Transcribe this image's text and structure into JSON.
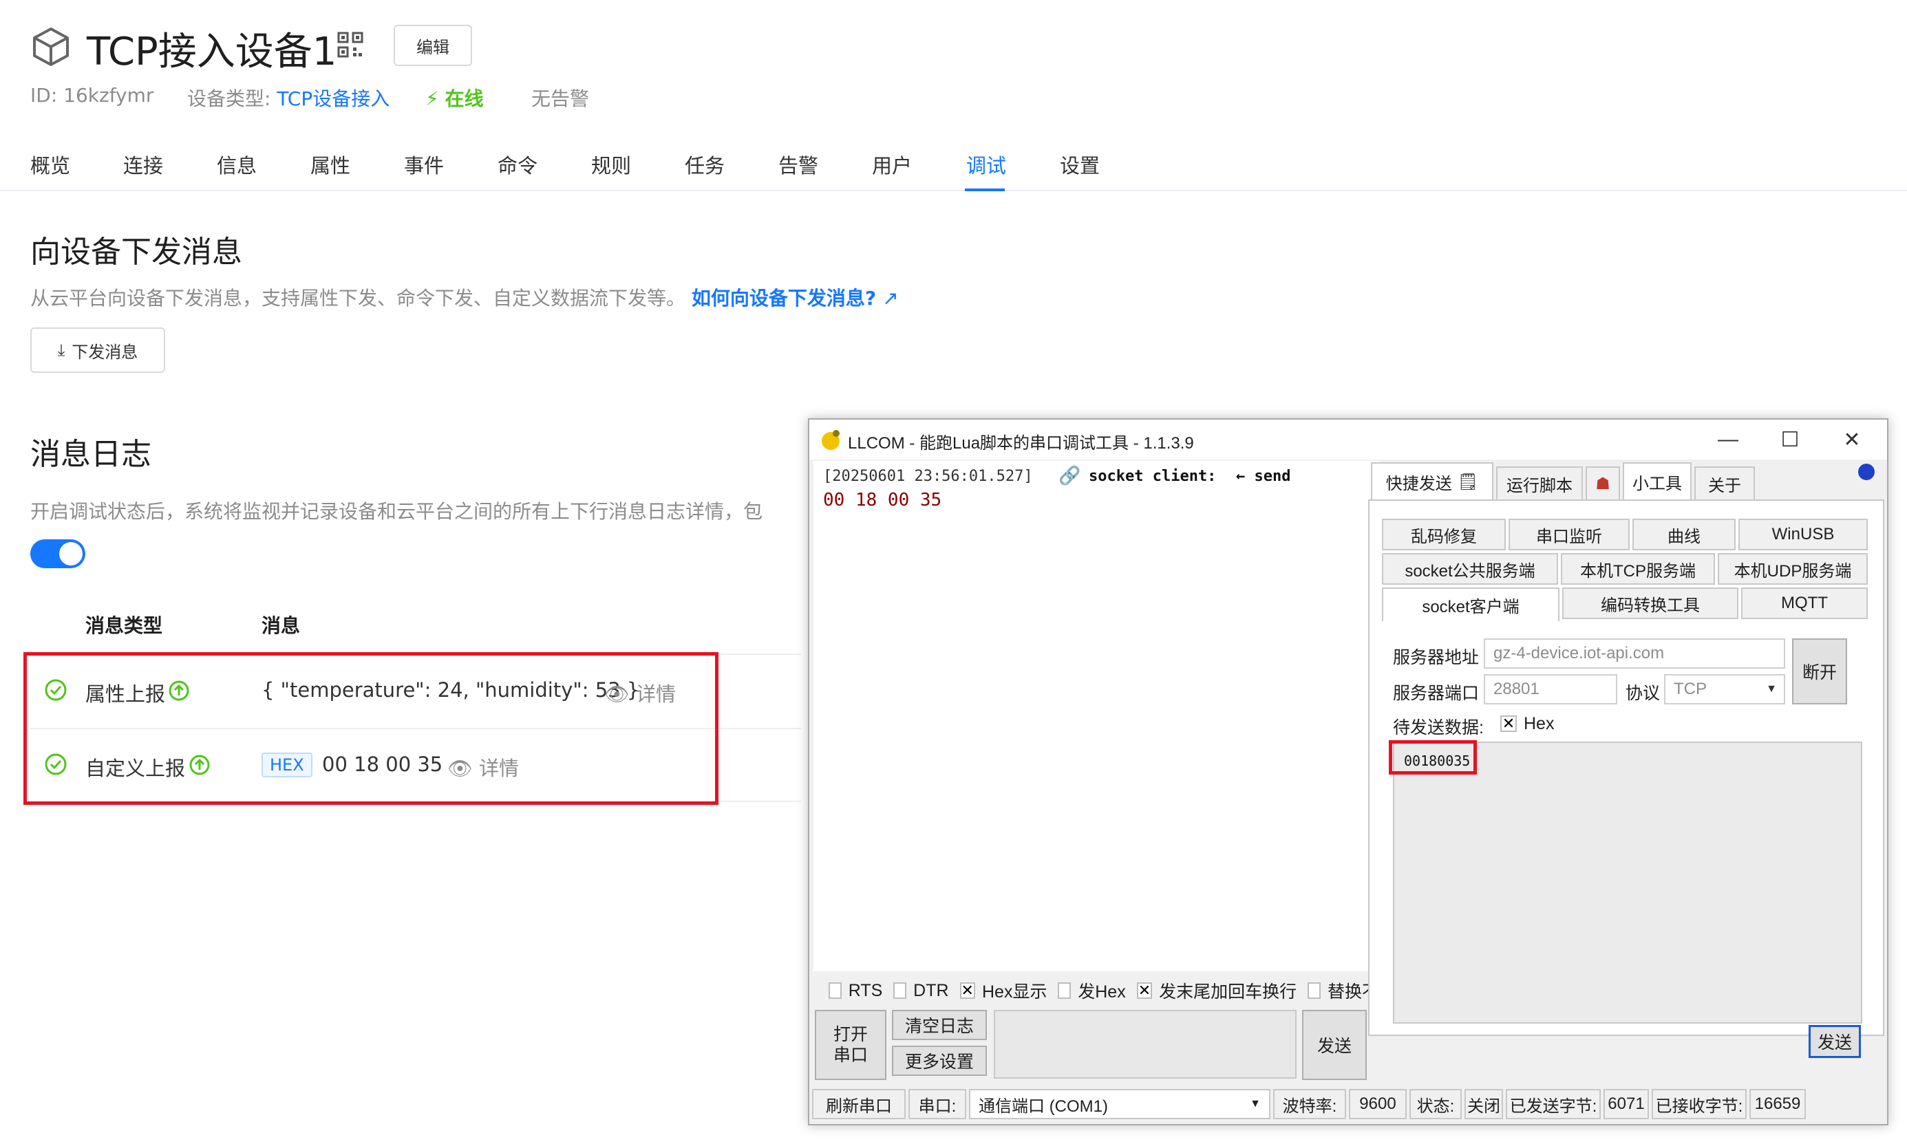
{
  "device": {
    "title": "TCP接入设备1",
    "edit_label": "编辑",
    "id_text": "ID: 16kzfymr",
    "type_label": "设备类型:",
    "type_value": "TCP设备接入",
    "status": "在线",
    "alarm": "无告警"
  },
  "tabs": [
    "概览",
    "连接",
    "信息",
    "属性",
    "事件",
    "命令",
    "规则",
    "任务",
    "告警",
    "用户",
    "调试",
    "设置"
  ],
  "active_tab": "调试",
  "send_section": {
    "title": "向设备下发消息",
    "desc": "从云平台向设备下发消息，支持属性下发、命令下发、自定义数据流下发等。",
    "help_link": "如何向设备下发消息?",
    "button": "下发消息"
  },
  "log_section": {
    "title": "消息日志",
    "desc": "开启调试状态后，系统将监视并记录设备和云平台之间的所有上下行消息日志详情，包",
    "toggle_on": true,
    "columns": [
      "消息类型",
      "消息"
    ],
    "rows": [
      {
        "type": "属性上报",
        "message": "{ \"temperature\": 24, \"humidity\": 53 }",
        "detail": "详情"
      },
      {
        "type": "自定义上报",
        "tag": "HEX",
        "message": "00 18 00 35",
        "detail": "详情"
      }
    ]
  },
  "llcom": {
    "title": "LLCOM - 能跑Lua脚本的串口调试工具 - 1.1.3.9",
    "log_header": "[20250601 23:56:01.527]",
    "log_source": "socket client:",
    "log_dir": "← send",
    "log_data": "00 18 00 35",
    "top_tabs": [
      "快捷发送",
      "运行脚本",
      "",
      "小工具",
      "关于"
    ],
    "tools_row1": [
      "乱码修复",
      "串口监听",
      "曲线",
      "WinUSB"
    ],
    "tools_row2": [
      "socket公共服务端",
      "本机TCP服务端",
      "本机UDP服务端"
    ],
    "tools_row3": [
      "socket客户端",
      "编码转换工具",
      "MQTT"
    ],
    "server_addr_label": "服务器地址",
    "server_addr": "gz-4-device.iot-api.com",
    "server_port_label": "服务器端口",
    "server_port": "28801",
    "protocol_label": "协议",
    "protocol": "TCP",
    "disconnect": "断开",
    "pending_label": "待发送数据:",
    "hex_label": "Hex",
    "pending_data": "00180035",
    "send_btn": "发送",
    "checks": [
      {
        "label": "RTS",
        "checked": false
      },
      {
        "label": "DTR",
        "checked": false
      },
      {
        "label": "Hex显示",
        "checked": true
      },
      {
        "label": "发Hex",
        "checked": false
      },
      {
        "label": "发末尾加回车换行",
        "checked": true
      },
      {
        "label": "替换不",
        "checked": false
      }
    ],
    "open_port": "打开\n串口",
    "clear_log": "清空日志",
    "more_settings": "更多设置",
    "bottom_send": "发送",
    "status_bar": {
      "refresh": "刷新串口",
      "port_label": "串口:",
      "port_value": "通信端口 (COM1)",
      "baud_label": "波特率:",
      "baud_value": "9600",
      "state_label": "状态:",
      "state_value": "关闭",
      "sent_label": "已发送字节:",
      "sent_value": "6071",
      "recv_label": "已接收字节:",
      "recv_value": "16659"
    }
  }
}
